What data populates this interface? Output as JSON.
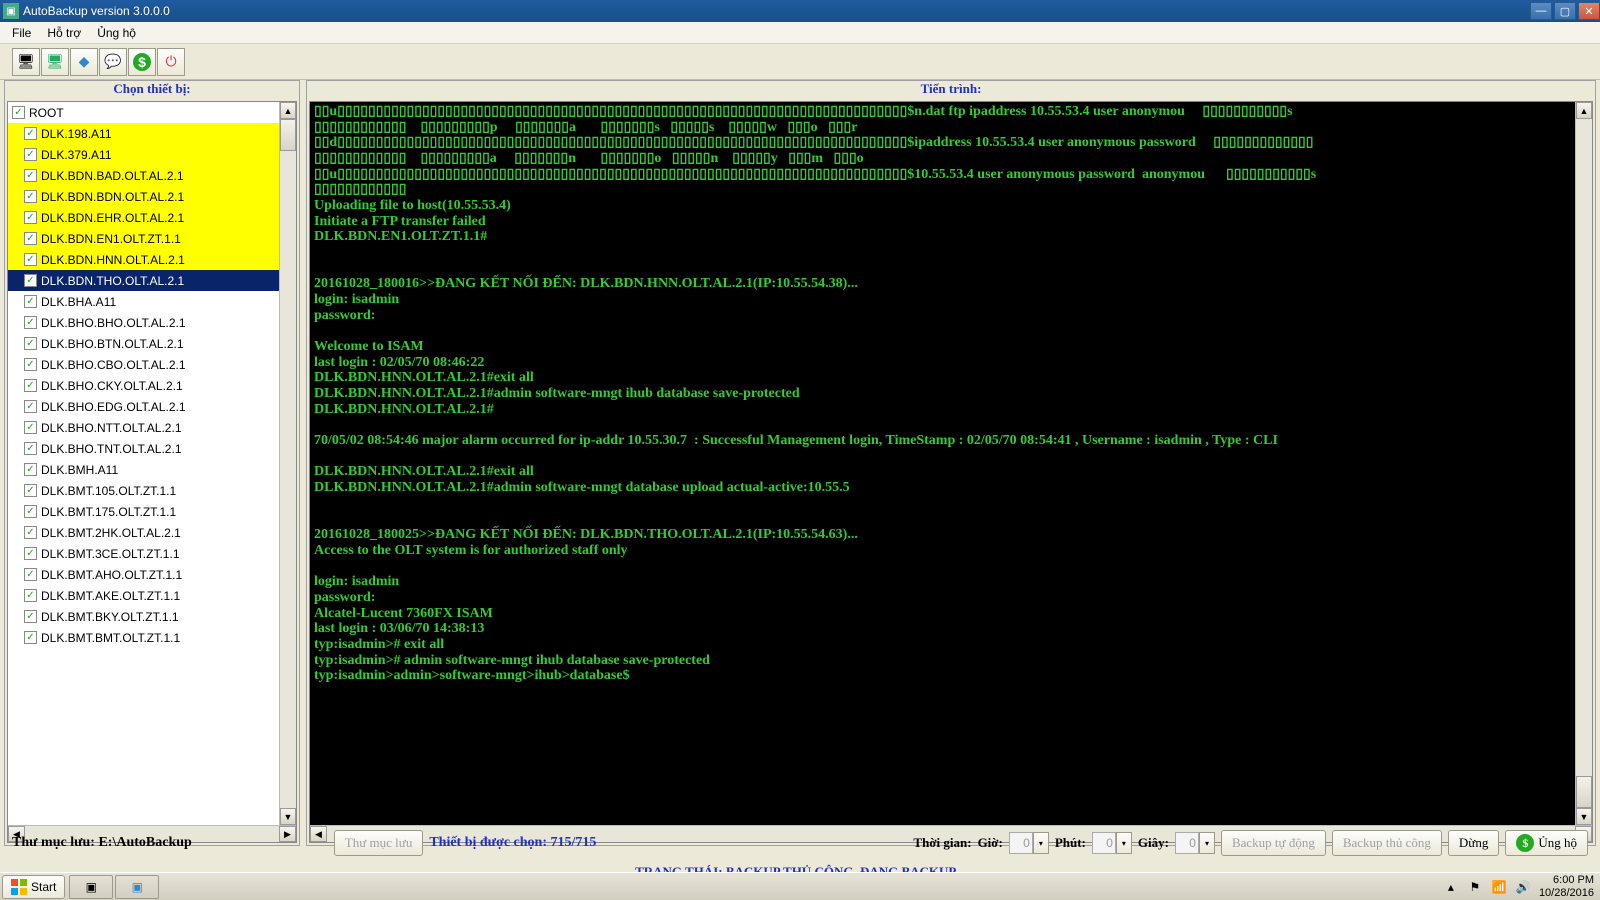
{
  "title": "AutoBackup version 3.0.0.0",
  "menu": [
    "File",
    "Hỗ trợ",
    "Ủng hộ"
  ],
  "toolbar_icons": [
    "screen",
    "screens",
    "diamond-blue",
    "bubble-blue",
    "dollar",
    "power-red"
  ],
  "left_header": "Chọn thiết bị:",
  "right_header": "Tiến trình:",
  "tree": {
    "root": "ROOT",
    "items": [
      {
        "label": "DLK.198.A11",
        "hl": "yellow"
      },
      {
        "label": "DLK.379.A11",
        "hl": "yellow"
      },
      {
        "label": "DLK.BDN.BAD.OLT.AL.2.1",
        "hl": "yellow"
      },
      {
        "label": "DLK.BDN.BDN.OLT.AL.2.1",
        "hl": "yellow"
      },
      {
        "label": "DLK.BDN.EHR.OLT.AL.2.1",
        "hl": "yellow"
      },
      {
        "label": "DLK.BDN.EN1.OLT.ZT.1.1",
        "hl": "yellow"
      },
      {
        "label": "DLK.BDN.HNN.OLT.AL.2.1",
        "hl": "yellow"
      },
      {
        "label": "DLK.BDN.THO.OLT.AL.2.1",
        "hl": "sel"
      },
      {
        "label": "DLK.BHA.A11",
        "hl": ""
      },
      {
        "label": "DLK.BHO.BHO.OLT.AL.2.1",
        "hl": ""
      },
      {
        "label": "DLK.BHO.BTN.OLT.AL.2.1",
        "hl": ""
      },
      {
        "label": "DLK.BHO.CBO.OLT.AL.2.1",
        "hl": ""
      },
      {
        "label": "DLK.BHO.CKY.OLT.AL.2.1",
        "hl": ""
      },
      {
        "label": "DLK.BHO.EDG.OLT.AL.2.1",
        "hl": ""
      },
      {
        "label": "DLK.BHO.NTT.OLT.AL.2.1",
        "hl": ""
      },
      {
        "label": "DLK.BHO.TNT.OLT.AL.2.1",
        "hl": ""
      },
      {
        "label": "DLK.BMH.A11",
        "hl": ""
      },
      {
        "label": "DLK.BMT.105.OLT.ZT.1.1",
        "hl": ""
      },
      {
        "label": "DLK.BMT.175.OLT.ZT.1.1",
        "hl": ""
      },
      {
        "label": "DLK.BMT.2HK.OLT.AL.2.1",
        "hl": ""
      },
      {
        "label": "DLK.BMT.3CE.OLT.ZT.1.1",
        "hl": ""
      },
      {
        "label": "DLK.BMT.AHO.OLT.ZT.1.1",
        "hl": ""
      },
      {
        "label": "DLK.BMT.AKE.OLT.ZT.1.1",
        "hl": ""
      },
      {
        "label": "DLK.BMT.BKY.OLT.ZT.1.1",
        "hl": ""
      },
      {
        "label": "DLK.BMT.BMT.OLT.ZT.1.1",
        "hl": ""
      }
    ]
  },
  "terminal_lines": [
    "▯▯u▯▯▯▯▯▯▯▯▯▯▯▯▯▯▯▯▯▯▯▯▯▯▯▯▯▯▯▯▯▯▯▯▯▯▯▯▯▯▯▯▯▯▯▯▯▯▯▯▯▯▯▯▯▯▯▯▯▯▯▯▯▯▯▯▯▯▯▯▯▯▯▯▯▯$n.dat ftp ipaddress 10.55.53.4 user anonymou     ▯▯▯▯▯▯▯▯▯▯▯s",
    "▯▯▯▯▯▯▯▯▯▯▯▯    ▯▯▯▯▯▯▯▯▯p     ▯▯▯▯▯▯▯a       ▯▯▯▯▯▯▯s   ▯▯▯▯▯s    ▯▯▯▯▯w   ▯▯▯o   ▯▯▯r",
    "▯▯d▯▯▯▯▯▯▯▯▯▯▯▯▯▯▯▯▯▯▯▯▯▯▯▯▯▯▯▯▯▯▯▯▯▯▯▯▯▯▯▯▯▯▯▯▯▯▯▯▯▯▯▯▯▯▯▯▯▯▯▯▯▯▯▯▯▯▯▯▯▯▯▯▯▯$ipaddress 10.55.53.4 user anonymous password     ▯▯▯▯▯▯▯▯▯▯▯▯▯",
    "▯▯▯▯▯▯▯▯▯▯▯▯    ▯▯▯▯▯▯▯▯▯a     ▯▯▯▯▯▯▯n       ▯▯▯▯▯▯▯o   ▯▯▯▯▯n    ▯▯▯▯▯y   ▯▯▯m   ▯▯▯o",
    "▯▯u▯▯▯▯▯▯▯▯▯▯▯▯▯▯▯▯▯▯▯▯▯▯▯▯▯▯▯▯▯▯▯▯▯▯▯▯▯▯▯▯▯▯▯▯▯▯▯▯▯▯▯▯▯▯▯▯▯▯▯▯▯▯▯▯▯▯▯▯▯▯▯▯▯▯$10.55.53.4 user anonymous password  anonymou      ▯▯▯▯▯▯▯▯▯▯▯s",
    "▯▯▯▯▯▯▯▯▯▯▯▯",
    "Uploading file to host(10.55.53.4)",
    "Initiate a FTP transfer failed",
    "DLK.BDN.EN1.OLT.ZT.1.1#",
    "",
    "",
    "20161028_180016>>ĐANG KẾT NỐI ĐẾN: DLK.BDN.HNN.OLT.AL.2.1(IP:10.55.54.38)...",
    "login: isadmin",
    "password:",
    "",
    "Welcome to ISAM",
    "last login : 02/05/70 08:46:22",
    "DLK.BDN.HNN.OLT.AL.2.1#exit all",
    "DLK.BDN.HNN.OLT.AL.2.1#admin software-mngt ihub database save-protected",
    "DLK.BDN.HNN.OLT.AL.2.1#",
    "",
    "70/05/02 08:54:46 major alarm occurred for ip-addr 10.55.30.7  : Successful Management login, TimeStamp : 02/05/70 08:54:41 , Username : isadmin , Type : CLI",
    "",
    "DLK.BDN.HNN.OLT.AL.2.1#exit all",
    "DLK.BDN.HNN.OLT.AL.2.1#admin software-mngt database upload actual-active:10.55.5",
    "",
    "",
    "20161028_180025>>ĐANG KẾT NỐI ĐẾN: DLK.BDN.THO.OLT.AL.2.1(IP:10.55.54.63)...",
    "Access to the OLT system is for authorized staff only",
    "",
    "login: isadmin",
    "password:",
    "Alcatel-Lucent 7360FX ISAM",
    "last login : 03/06/70 14:38:13",
    "typ:isadmin># exit all",
    "typ:isadmin># admin software-mngt ihub database save-protected",
    "typ:isadmin>admin>software-mngt>ihub>database$"
  ],
  "bottom": {
    "save_dir_label": "Thư mục lưu: ",
    "save_dir_value": "E:\\AutoBackup",
    "save_dir_btn": "Thư mục lưu",
    "selected_label": "Thiết bị được chọn: ",
    "selected_value": "715/715",
    "time_label": "Thời gian:",
    "hour_label": "Giờ:",
    "hour_value": "0",
    "minute_label": "Phút:",
    "minute_value": "0",
    "second_label": "Giây:",
    "second_value": "0",
    "auto_btn": "Backup tự động",
    "manual_btn": "Backup thủ công",
    "stop_btn": "Dừng",
    "support_btn": "Ủng hộ"
  },
  "status_line": "TRẠNG THÁI: BACKUP THỦ CÔNG, ĐANG BACKUP...",
  "taskbar": {
    "start": "Start",
    "clock_time": "6:00 PM",
    "clock_date": "10/28/2016"
  }
}
